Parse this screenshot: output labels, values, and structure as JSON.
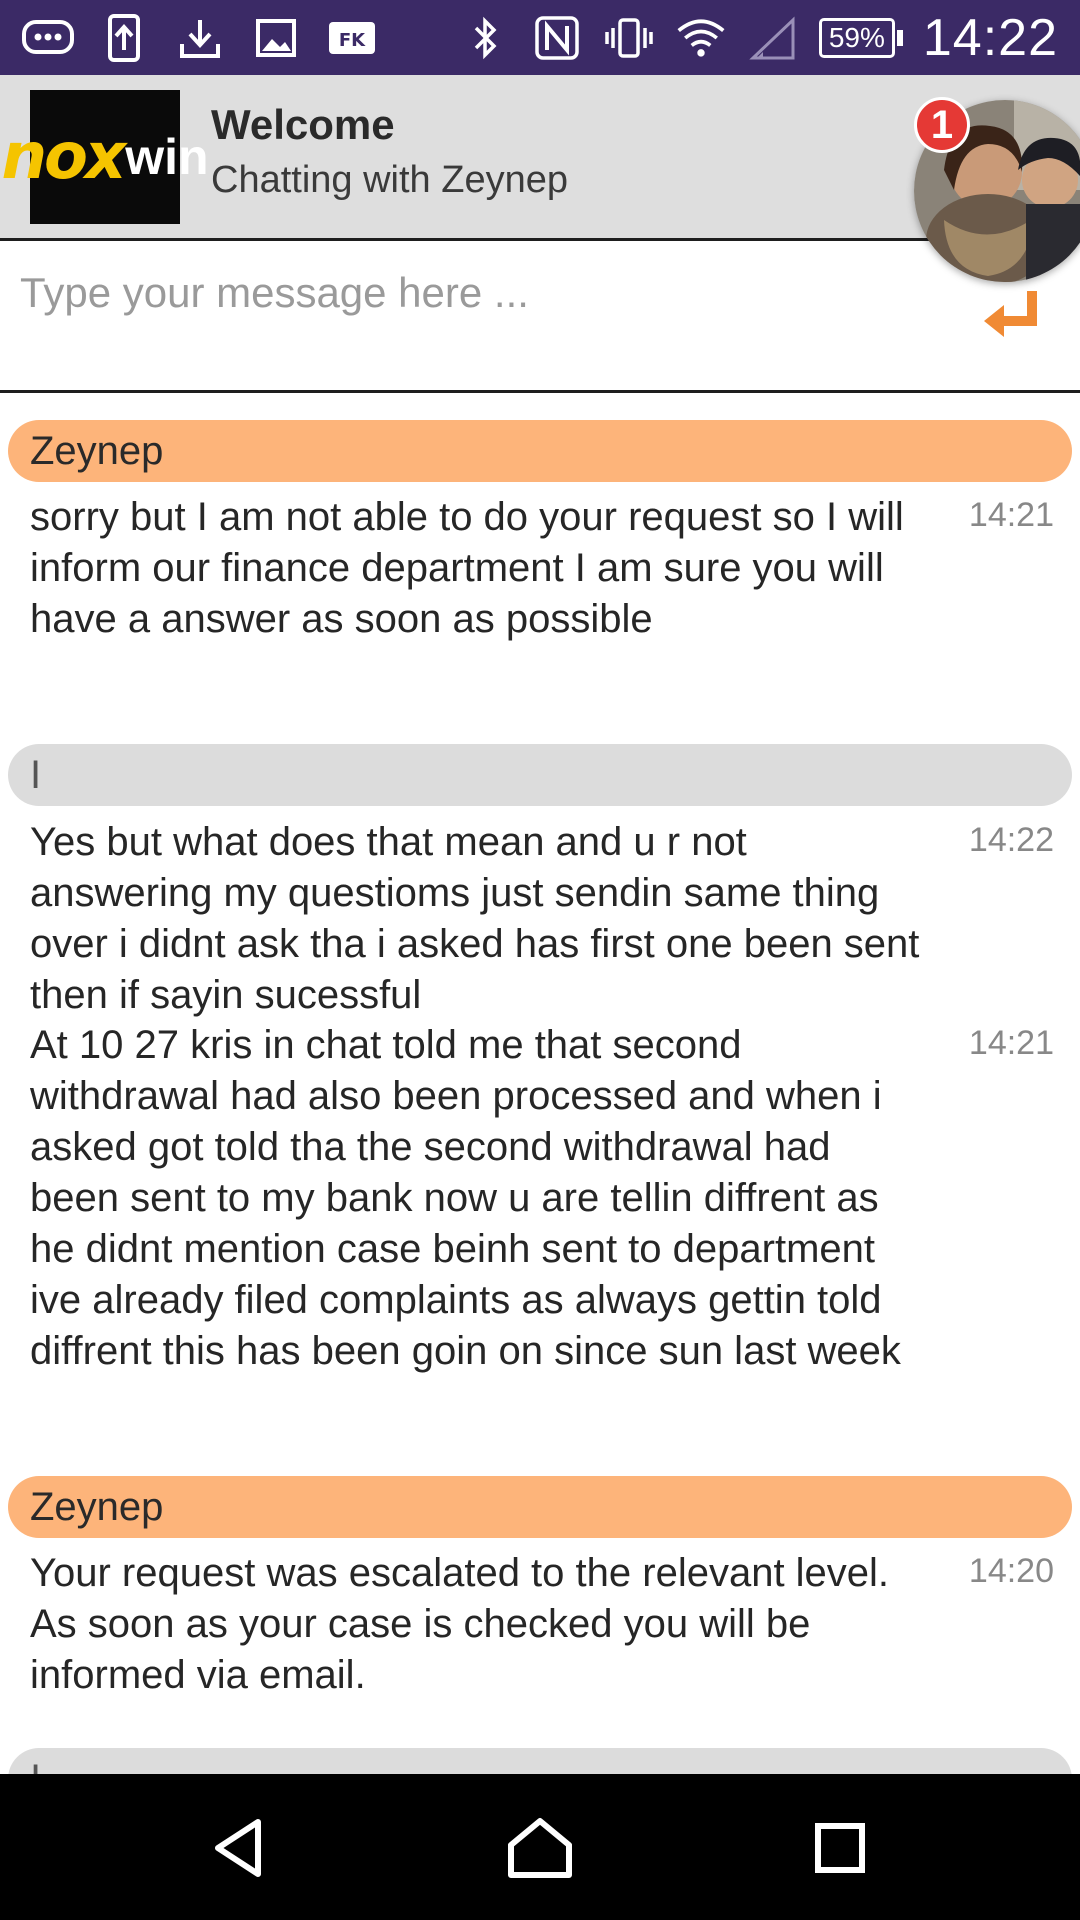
{
  "status_bar": {
    "time": "14:22",
    "battery": "59%",
    "left_icons": [
      "chat-bubble-icon",
      "upload-phone-icon",
      "download-icon",
      "image-icon",
      "fk-app-icon"
    ],
    "right_icons": [
      "bluetooth-icon",
      "nfc-icon",
      "vibrate-icon",
      "wifi-icon",
      "signal-icon"
    ]
  },
  "header": {
    "logo_part1": "nox",
    "logo_part2": "win",
    "title": "Welcome",
    "subtitle": "Chatting with Zeynep",
    "notification_count": "1"
  },
  "composer": {
    "placeholder": "Type your message here ...",
    "value": ""
  },
  "messages": [
    {
      "sender": "Zeynep",
      "role": "agent",
      "entries": [
        {
          "text": "sorry but I am not able to do your request so I will inform our finance department I am sure you will have a answer as soon as possible",
          "time": "14:21"
        }
      ]
    },
    {
      "sender": "I",
      "role": "user",
      "entries": [
        {
          "text": "Yes but what does that mean and u r not answering my questioms just sendin same thing over i didnt ask tha i asked has first one been sent then if sayin sucessful",
          "time": "14:22"
        },
        {
          "text": "At 10 27 kris in chat told me that second withdrawal had also been processed and when i asked got told tha the second withdrawal had been sent to my bank now u are tellin diffrent as he didnt mention case beinh sent to department ive already filed complaints as always gettin told diffrent this has been goin on since sun last week",
          "time": "14:21"
        }
      ]
    },
    {
      "sender": "Zeynep",
      "role": "agent",
      "entries": [
        {
          "text": "Your request was escalated to the relevant level. As soon as your case is checked you will be informed via email.",
          "time": "14:20"
        }
      ]
    },
    {
      "sender": "I",
      "role": "user",
      "entries": []
    }
  ],
  "colors": {
    "status_bar": "#3b2a66",
    "agent_bubble": "#fdb47a",
    "user_bubble": "#dcdcdc",
    "accent": "#f08a34"
  }
}
